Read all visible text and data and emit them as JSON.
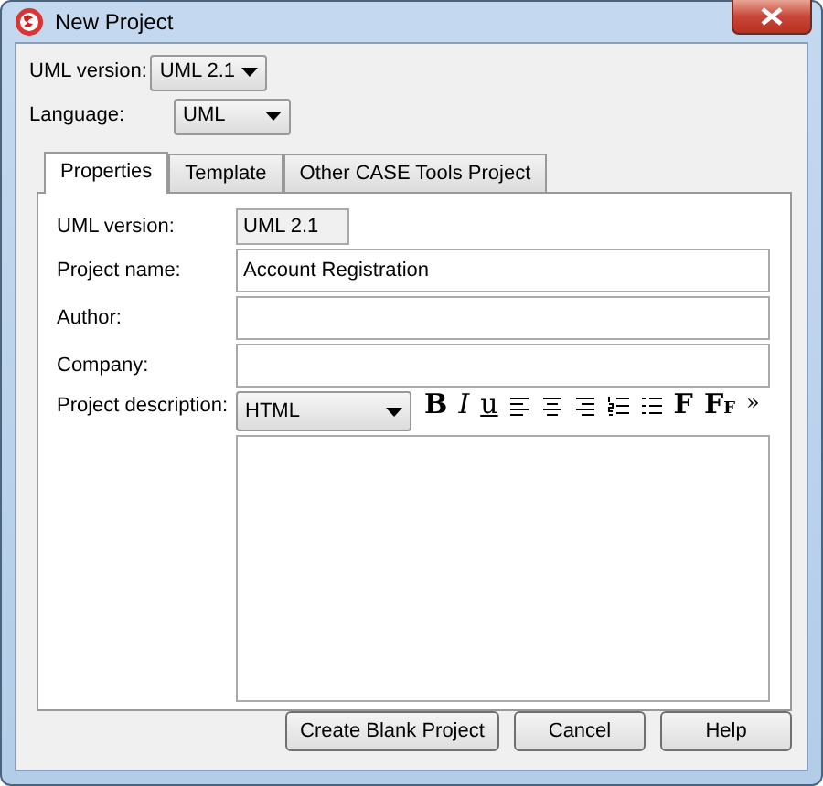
{
  "window": {
    "title": "New Project"
  },
  "top_fields": [
    {
      "label": "UML version:",
      "value": "UML 2.1"
    },
    {
      "label": "Language:",
      "value": "UML"
    }
  ],
  "tabs": [
    {
      "label": "Properties",
      "selected": true
    },
    {
      "label": "Template",
      "selected": false
    },
    {
      "label": "Other CASE Tools Project",
      "selected": false
    }
  ],
  "properties": {
    "uml_version": {
      "label": "UML version:",
      "value": "UML 2.1"
    },
    "fields": [
      {
        "label": "Project name:",
        "value": "Account Registration"
      },
      {
        "label": "Author:"
      },
      {
        "label": "Company:"
      }
    ],
    "description": {
      "label": "Project description:",
      "format": "HTML",
      "toolbar": [
        {
          "kind": "bold",
          "text": "B"
        },
        {
          "kind": "italic",
          "text": "I"
        },
        {
          "kind": "underline",
          "text": "u"
        },
        {
          "kind": "align-left"
        },
        {
          "kind": "align-center"
        },
        {
          "kind": "align-right"
        },
        {
          "kind": "numbered-list"
        },
        {
          "kind": "bullet-list"
        },
        {
          "kind": "font",
          "text": "F"
        },
        {
          "kind": "font-size",
          "text": "F",
          "sub": "F"
        },
        {
          "kind": "more",
          "text": "»"
        }
      ]
    }
  },
  "buttons": [
    "Create Blank Project",
    "Cancel",
    "Help"
  ]
}
